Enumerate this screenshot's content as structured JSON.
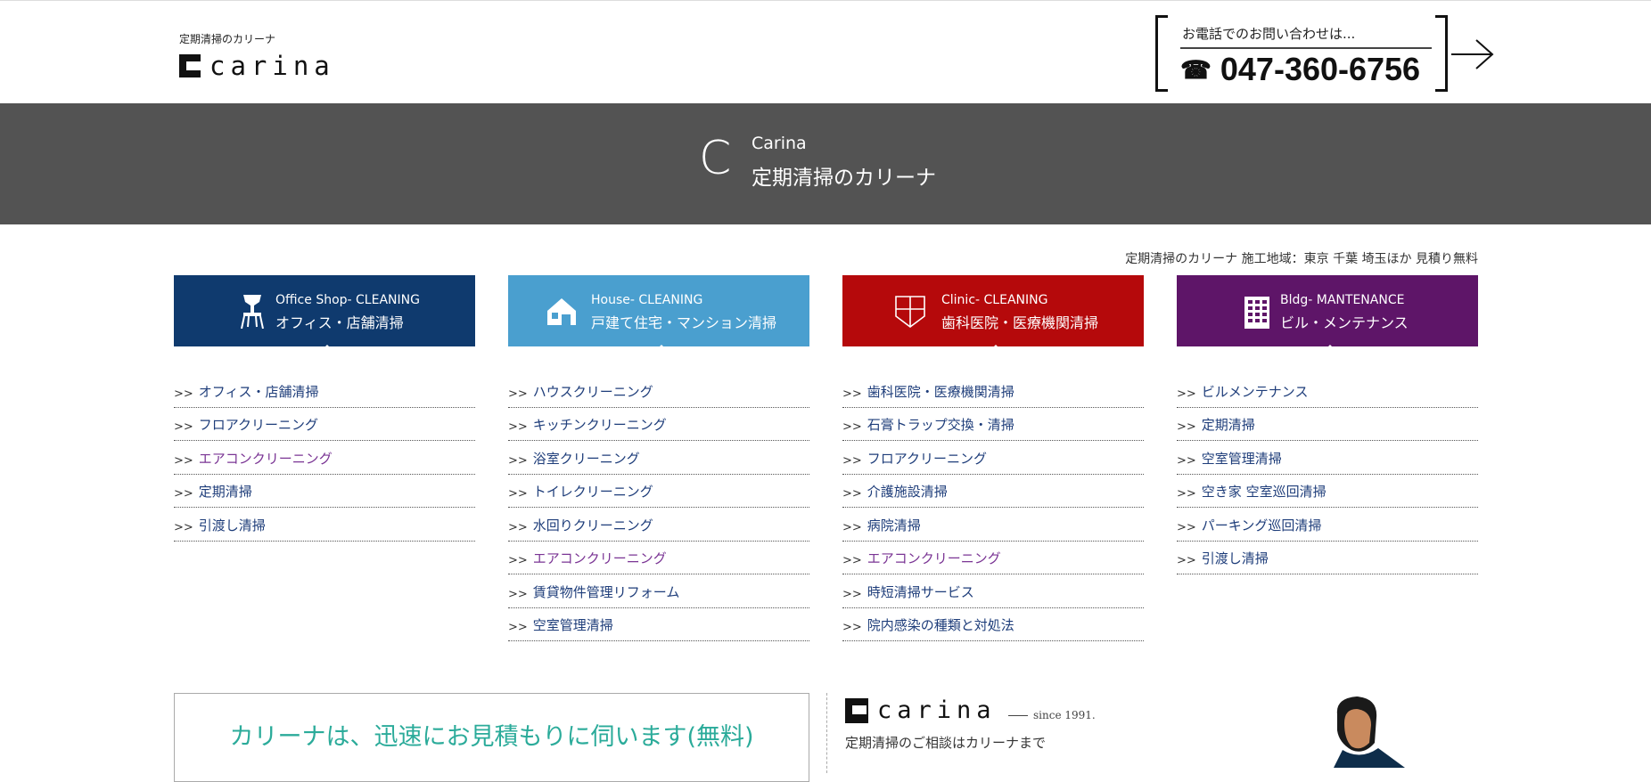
{
  "header": {
    "logo_sub": "定期清掃のカリーナ",
    "logo_text": "carina",
    "phone_label": "お電話でのお問い合わせは...",
    "phone_icon": "☎",
    "phone_number": "047-360-6756"
  },
  "banner": {
    "mark": "C",
    "title_en": "Carina",
    "title_jp": "定期清掃のカリーナ"
  },
  "area_text": "定期清掃のカリーナ 施工地域：東京 千葉 埼玉ほか 見積り無料",
  "arrow_prefix": ">>",
  "categories": [
    {
      "title_en": "Office Shop- CLEANING",
      "title_jp": "オフィス・店舗清掃",
      "color": "#0f3a6e",
      "icon": "chair-icon",
      "items": [
        {
          "label": "オフィス・店舗清掃",
          "visited": false
        },
        {
          "label": "フロアクリーニング",
          "visited": false
        },
        {
          "label": "エアコンクリーニング",
          "visited": true
        },
        {
          "label": "定期清掃",
          "visited": false
        },
        {
          "label": "引渡し清掃",
          "visited": false
        }
      ]
    },
    {
      "title_en": "House- CLEANING",
      "title_jp": "戸建て住宅・マンション清掃",
      "color": "#4a9fcf",
      "icon": "house-icon",
      "items": [
        {
          "label": "ハウスクリーニング",
          "visited": false
        },
        {
          "label": "キッチンクリーニング",
          "visited": false
        },
        {
          "label": "浴室クリーニング",
          "visited": false
        },
        {
          "label": "トイレクリーニング",
          "visited": false
        },
        {
          "label": "水回りクリーニング",
          "visited": false
        },
        {
          "label": "エアコンクリーニング",
          "visited": true
        },
        {
          "label": "賃貸物件管理リフォーム",
          "visited": false
        },
        {
          "label": "空室管理清掃",
          "visited": false
        }
      ]
    },
    {
      "title_en": "Clinic- CLEANING",
      "title_jp": "歯科医院・医療機関清掃",
      "color": "#b5090b",
      "icon": "medical-cross-icon",
      "items": [
        {
          "label": "歯科医院・医療機関清掃",
          "visited": false
        },
        {
          "label": "石膏トラップ交換・清掃",
          "visited": false
        },
        {
          "label": "フロアクリーニング",
          "visited": false
        },
        {
          "label": "介護施設清掃",
          "visited": false
        },
        {
          "label": "病院清掃",
          "visited": false
        },
        {
          "label": "エアコンクリーニング",
          "visited": true
        },
        {
          "label": "時短清掃サービス",
          "visited": false
        },
        {
          "label": "院内感染の種類と対処法",
          "visited": false
        }
      ]
    },
    {
      "title_en": "Bldg- MANTENANCE",
      "title_jp": "ビル・メンテナンス",
      "color": "#5e1568",
      "icon": "building-icon",
      "items": [
        {
          "label": "ビルメンテナンス",
          "visited": false
        },
        {
          "label": "定期清掃",
          "visited": false
        },
        {
          "label": "空室管理清掃",
          "visited": false
        },
        {
          "label": "空き家 空室巡回清掃",
          "visited": false
        },
        {
          "label": "パーキング巡回清掃",
          "visited": false
        },
        {
          "label": "引渡し清掃",
          "visited": false
        }
      ]
    }
  ],
  "bottom": {
    "quote_text": "カリーナは、迅速にお見積もりに伺います(無料)",
    "logo_text": "carina",
    "since": "since 1991.",
    "consult": "定期清掃のご相談はカリーナまで"
  }
}
